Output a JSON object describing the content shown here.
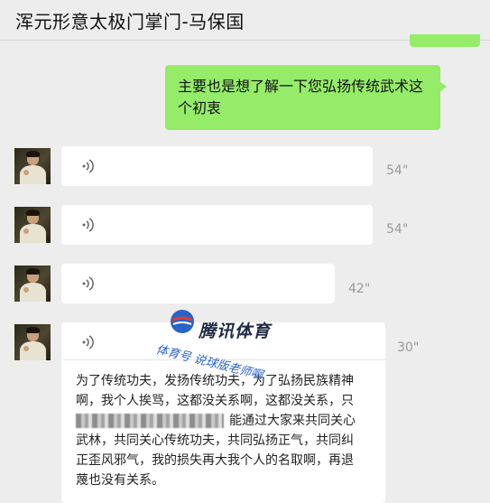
{
  "header": {
    "title": "浑元形意太极门掌门-马保国"
  },
  "messages": {
    "sent": {
      "text": "主要也是想了解一下您弘扬传统武术这个初衷"
    },
    "voice": [
      {
        "duration": "54\""
      },
      {
        "duration": "54\""
      },
      {
        "duration": "42\""
      },
      {
        "duration": "30\""
      }
    ],
    "transcript": {
      "line1": "为了传统功夫，发扬传统功夫，为了弘扬民族精神",
      "line2": "啊，我个人挨骂，这都没关系啊，这都没关系，只",
      "line3_tail": "能通过大家来共同关心",
      "line4": "武林，共同关心传统功夫，共同弘扬正气，共同纠",
      "line5": "正歪风邪气，我的损失再大我个人的名取啊，再退",
      "line6": "蔑也没有关系。"
    }
  },
  "watermark": {
    "brand": "腾讯体育",
    "sub": "体育号 说球版老师啊"
  },
  "colors": {
    "sent_bubble": "#95ec69",
    "received_bubble": "#ffffff",
    "background": "#ededed"
  },
  "icons": {
    "voice": "voice-wave-icon",
    "avatar": "avatar-photo"
  }
}
